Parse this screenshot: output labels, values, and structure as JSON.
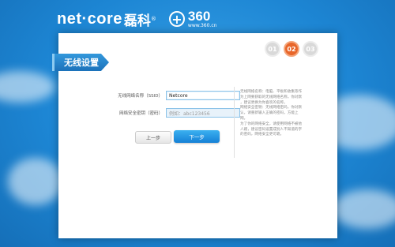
{
  "header": {
    "logo_text": "net·core",
    "logo_cn": "磊科",
    "reg_mark": "®",
    "partner_plus": "+",
    "partner_name": "360",
    "partner_url": "www.360.cn"
  },
  "steps": [
    "01",
    "02",
    "03"
  ],
  "active_step": 1,
  "page_title": "无线设置",
  "form": {
    "ssid_label": "无线网络名称（SSID）",
    "ssid_value": "Netcore",
    "password_label": "网络安全密钥（密码）",
    "password_placeholder": "例如：abc123456"
  },
  "buttons": {
    "prev": "上一步",
    "next": "下一步"
  },
  "help_lines": [
    "无线网络名称：电脑、平板和收集等作",
    "为上网要获取的无线网络名称，你对默",
    "，建议更换为你喜欢的名称。",
    "网络安全密钥：无线网络密码，你对默",
    "认，请重新输入正确的密码，方能上",
    "网。",
    "为了你的网络安全，请使用网络不被他",
    "人蹭，建议密码设置成别人不知道的字",
    "的密码，网络安全更可靠。"
  ],
  "colors": {
    "accent_blue": "#1c72ba",
    "active_step": "#e8662a"
  }
}
